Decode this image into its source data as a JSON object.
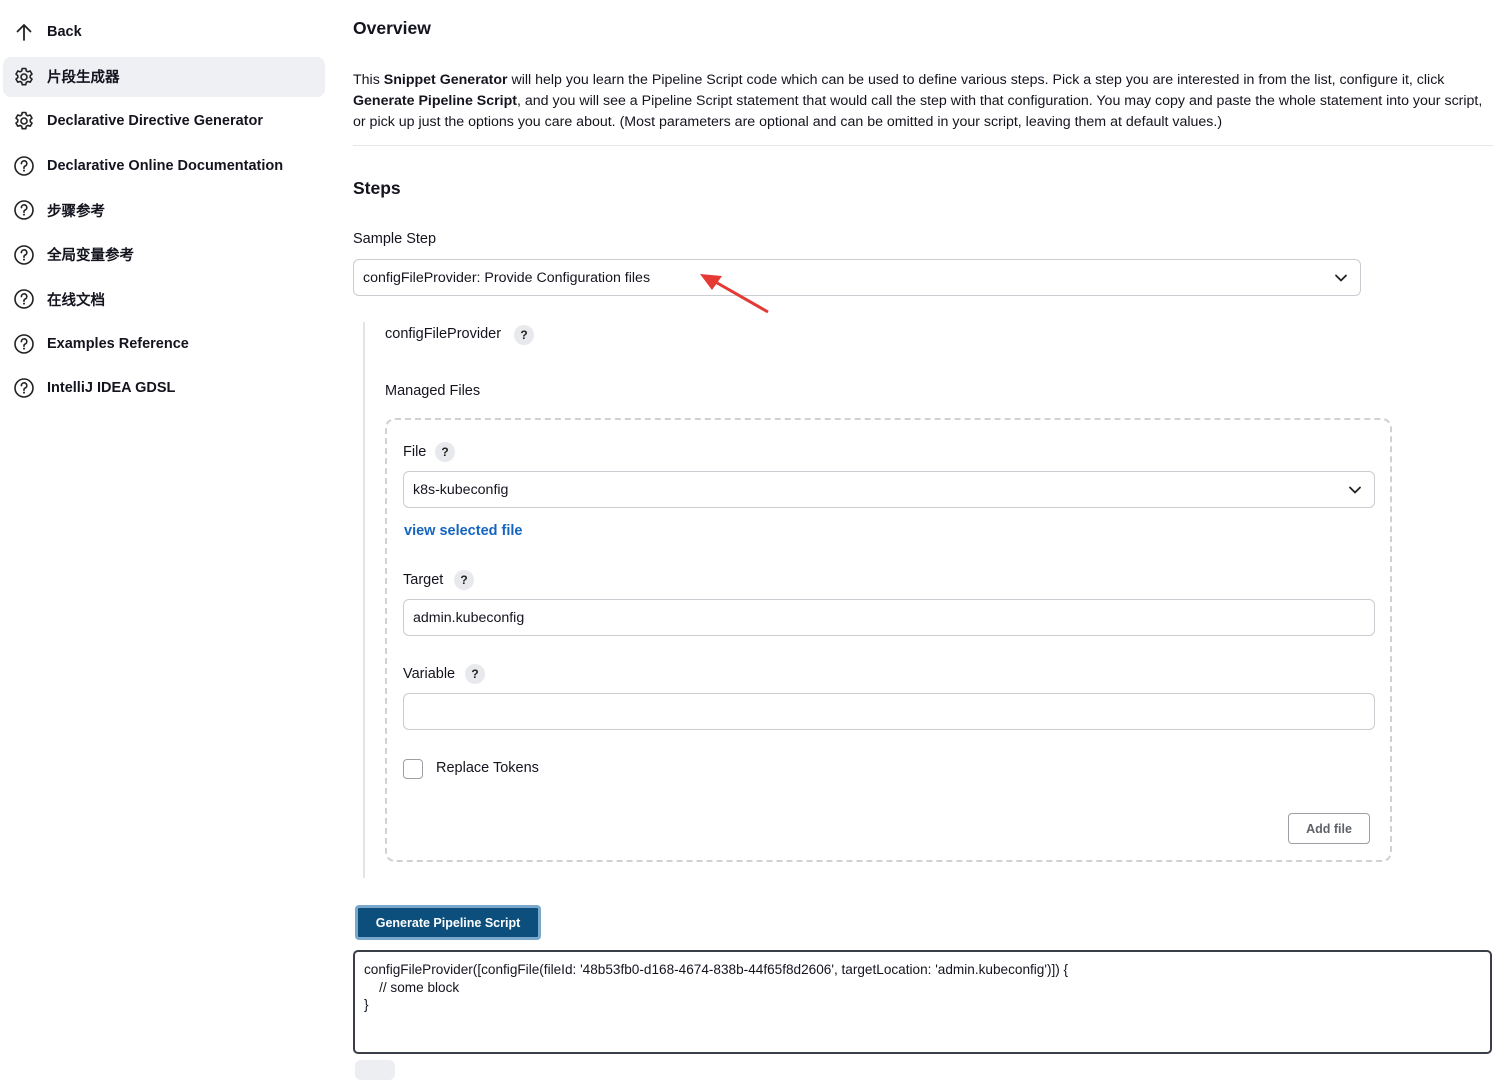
{
  "sidebar": {
    "items": [
      {
        "label": "Back",
        "icon": "arrow-up-icon"
      },
      {
        "label": "片段生成器",
        "icon": "gear-icon"
      },
      {
        "label": "Declarative Directive Generator",
        "icon": "gear-icon"
      },
      {
        "label": "Declarative Online Documentation",
        "icon": "help-circle-icon"
      },
      {
        "label": "步骤参考",
        "icon": "help-circle-icon"
      },
      {
        "label": "全局变量参考",
        "icon": "help-circle-icon"
      },
      {
        "label": "在线文档",
        "icon": "help-circle-icon"
      },
      {
        "label": "Examples Reference",
        "icon": "help-circle-icon"
      },
      {
        "label": "IntelliJ IDEA GDSL",
        "icon": "help-circle-icon"
      }
    ],
    "active_index": 1
  },
  "overview": {
    "title": "Overview",
    "desc_p1": "This ",
    "desc_b1": "Snippet Generator",
    "desc_p2": " will help you learn the Pipeline Script code which can be used to define various steps. Pick a step you are interested in from the list, configure it, click ",
    "desc_b2": "Generate Pipeline Script",
    "desc_p3": ", and you will see a Pipeline Script statement that would call the step with that configuration. You may copy and paste the whole statement into your script, or pick up just the options you care about. (Most parameters are optional and can be omitted in your script, leaving them at default values.)"
  },
  "steps": {
    "title": "Steps",
    "sample_step_label": "Sample Step",
    "sample_step_value": "configFileProvider: Provide Configuration files",
    "step_name": "configFileProvider",
    "help_glyph": "?",
    "managed_files_label": "Managed Files",
    "file_label": "File",
    "file_value": "k8s-kubeconfig",
    "view_file_link": "view selected file",
    "target_label": "Target",
    "target_value": "admin.kubeconfig",
    "variable_label": "Variable",
    "variable_value": "",
    "replace_tokens_label": "Replace Tokens",
    "replace_tokens_checked": false,
    "add_file_label": "Add file",
    "generate_label": "Generate Pipeline Script",
    "output": "configFileProvider([configFile(fileId: '48b53fb0-d168-4674-838b-44f65f8d2606', targetLocation: 'admin.kubeconfig')]) {\n    // some block\n}"
  },
  "colors": {
    "primary_button": "#0c4f7d",
    "link": "#1565c0",
    "annotation_arrow": "#e53935"
  }
}
